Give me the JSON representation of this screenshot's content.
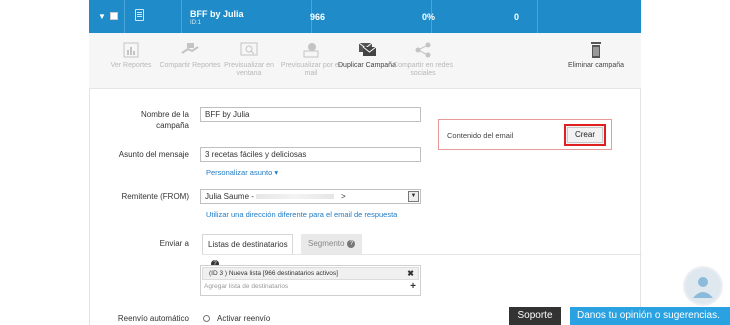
{
  "header": {
    "campaign_name": "BFF by Julia",
    "campaign_id": "ID:1",
    "col1": "966",
    "col2": "0%",
    "col3": "0"
  },
  "toolbar": {
    "items": [
      {
        "label": "Ver Reportes",
        "icon": "chart-icon",
        "enabled": false
      },
      {
        "label": "Compartir Reportes",
        "icon": "share-hands-icon",
        "enabled": false
      },
      {
        "label": "Previsualizar en ventana",
        "icon": "preview-window-icon",
        "enabled": false
      },
      {
        "label": "Previsualizar por e-mail",
        "icon": "preview-email-icon",
        "enabled": false
      },
      {
        "label": "Duplicar Campaña",
        "icon": "duplicate-envelope-icon",
        "enabled": true
      },
      {
        "label": "Compartir en redes sociales",
        "icon": "social-share-icon",
        "enabled": false
      },
      {
        "label": "Eliminar campaña",
        "icon": "trash-icon",
        "enabled": true
      }
    ]
  },
  "form": {
    "name_label": "Nombre de la campaña",
    "name_value": "BFF by Julia",
    "subject_label": "Asunto del mensaje",
    "subject_value": "3 recetas fáciles y deliciosas",
    "personalize_link": "Personalizar asunto ▾",
    "sender_label": "Remitente (FROM)",
    "sender_value": "Julia Saume -",
    "sender_suffix": ">",
    "reply_link": "Utilizar una dirección diferente para el email de respuesta",
    "send_to_label": "Enviar a",
    "tab_lists": "Listas de destinatarios",
    "tab_segment": "Segmento",
    "dest_item": "(ID 3 ) Nueva lista [966 destinatarios activos]",
    "dest_add": "Agregar lista de destinatarios",
    "resend_label": "Reenvío automático",
    "resend_option": "Activar reenvío"
  },
  "email_content": {
    "label": "Contenido del email",
    "create_button": "Crear"
  },
  "footer": {
    "support": "Soporte",
    "feedback": "Danos tu opinión o sugerencias."
  },
  "colors": {
    "header_blue": "#1f8cc9",
    "highlight_red": "#e02020",
    "feedback_blue": "#2aa1e0"
  }
}
